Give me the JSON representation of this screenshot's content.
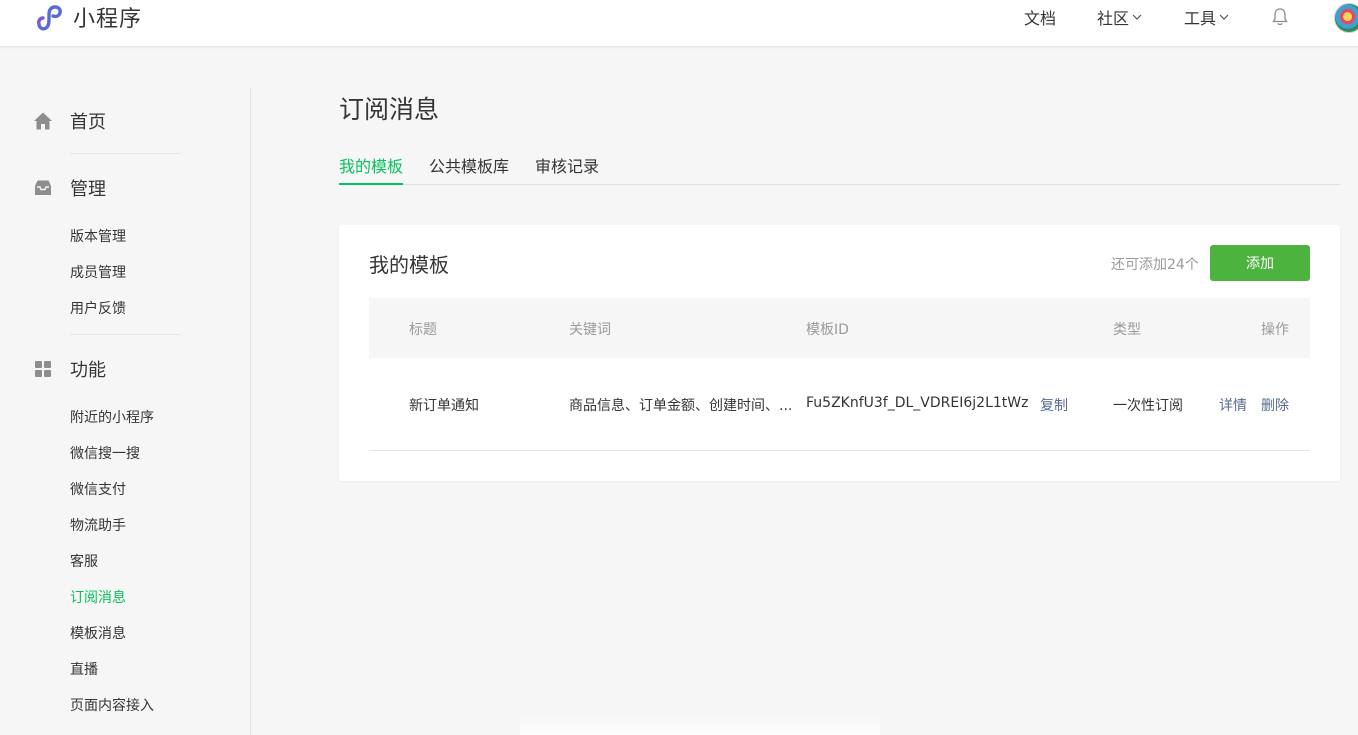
{
  "header": {
    "logo_text": "小程序",
    "nav": {
      "docs": "文档",
      "community": "社区",
      "tools": "工具"
    }
  },
  "sidebar": {
    "home": "首页",
    "manage": {
      "title": "管理",
      "items": [
        "版本管理",
        "成员管理",
        "用户反馈"
      ]
    },
    "features": {
      "title": "功能",
      "items": [
        "附近的小程序",
        "微信搜一搜",
        "微信支付",
        "物流助手",
        "客服",
        "订阅消息",
        "模板消息",
        "直播",
        "页面内容接入"
      ],
      "active": "订阅消息"
    }
  },
  "main": {
    "page_title": "订阅消息",
    "tabs": [
      "我的模板",
      "公共模板库",
      "审核记录"
    ],
    "active_tab": "我的模板",
    "card": {
      "title": "我的模板",
      "remaining": "还可添加24个",
      "add_label": "添加",
      "columns": [
        "标题",
        "关键词",
        "模板ID",
        "类型",
        "操作"
      ],
      "rows": [
        {
          "title": "新订单通知",
          "keywords": "商品信息、订单金额、创建时间、...",
          "template_id": "Fu5ZKnfU3f_DL_VDREI6j2L1tWz...",
          "copy_label": "复制",
          "type": "一次性订阅",
          "detail_label": "详情",
          "delete_label": "删除"
        }
      ]
    }
  },
  "colors": {
    "accent": "#07c160",
    "button": "#4bb33e",
    "link": "#576b95"
  }
}
